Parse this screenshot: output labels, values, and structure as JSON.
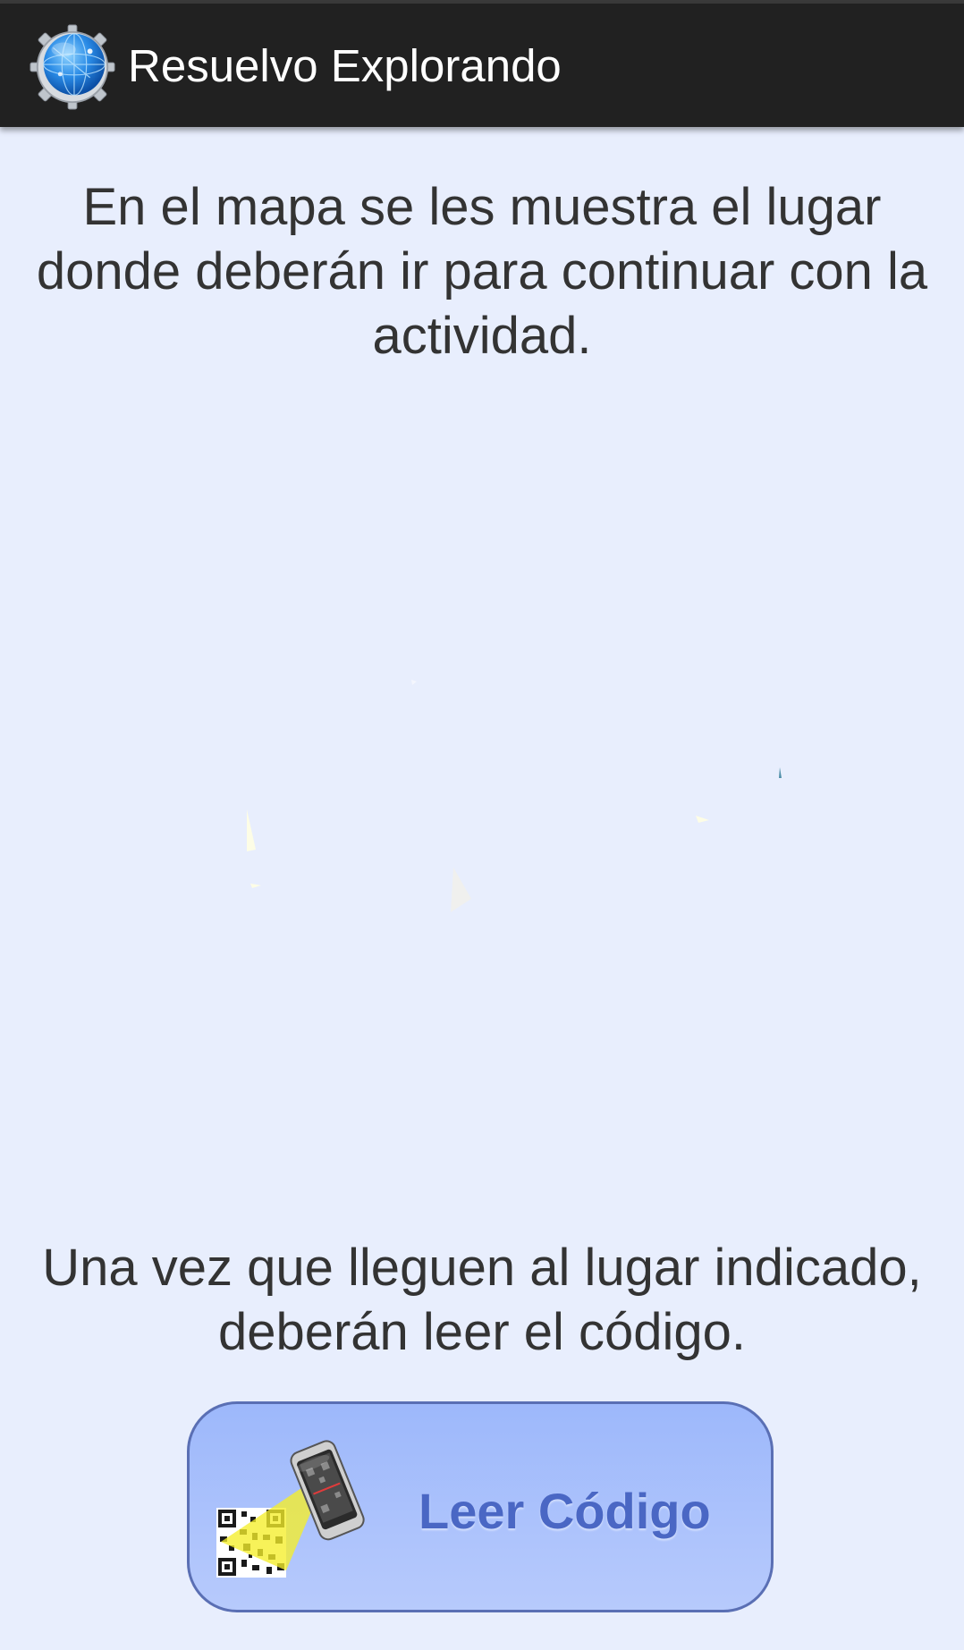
{
  "app": {
    "title": "Resuelvo Explorando",
    "icon": "globe-gear-icon"
  },
  "content": {
    "intro": "En el mapa se les muestra el lugar donde deberán ir para continuar con la actividad.",
    "instruction": "Una vez que lleguen al lugar indicado, deberán leer el código."
  },
  "scan_button": {
    "label": "Leer Código",
    "icon": "qr-phone-scan-icon"
  },
  "colors": {
    "action_bar": "#212121",
    "background": "#e8eefd",
    "button_fill": "#a6bffb",
    "button_border": "#5a6fb4",
    "button_text": "#4a67c4"
  }
}
